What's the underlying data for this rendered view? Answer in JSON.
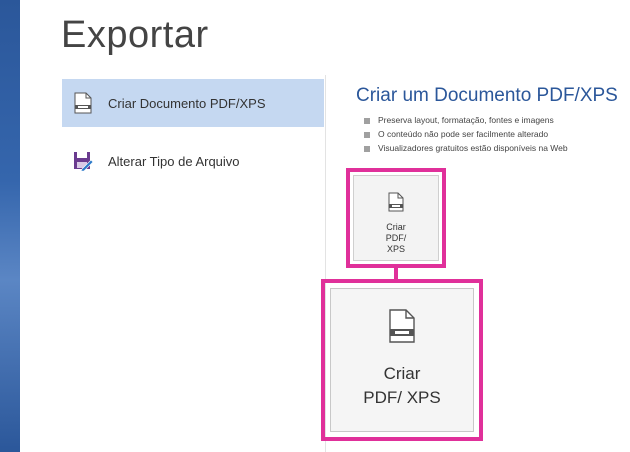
{
  "page": {
    "title": "Exportar"
  },
  "nav": {
    "items": [
      {
        "label": "Criar Documento PDF/XPS",
        "icon": "pdf-document-icon",
        "active": true
      },
      {
        "label": "Alterar Tipo de Arquivo",
        "icon": "save-as-file-type-icon",
        "active": false
      }
    ]
  },
  "detail": {
    "title": "Criar um Documento PDF/XPS",
    "bullets": [
      "Preserva layout, formatação, fontes e imagens",
      "O conteúdo não pode ser facilmente alterado",
      "Visualizadores gratuitos estão disponíveis na Web"
    ],
    "button_small_label": "Criar PDF/ XPS",
    "button_big_label": "Criar PDF/ XPS"
  },
  "colors": {
    "accent_blue": "#2b579a",
    "highlight_magenta": "#e0309a",
    "active_nav_bg": "#c5d8f1"
  }
}
